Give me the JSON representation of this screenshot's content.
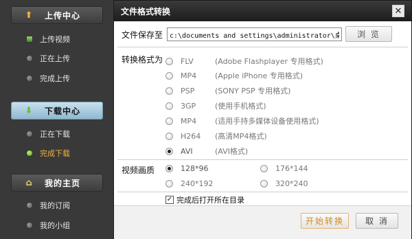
{
  "sidebar": {
    "upload": {
      "header": "上传中心",
      "icon": "up-arrow-icon",
      "items": [
        {
          "label": "上传视频",
          "icon": "video-icon"
        },
        {
          "label": "正在上传",
          "icon": "dot-icon"
        },
        {
          "label": "完成上传",
          "icon": "dot-icon"
        }
      ]
    },
    "download": {
      "header": "下载中心",
      "icon": "down-arrow-icon",
      "items": [
        {
          "label": "正在下载",
          "icon": "dot-icon"
        },
        {
          "label": "完成下载",
          "icon": "check-dot-icon",
          "selected": true
        }
      ]
    },
    "home": {
      "header": "我的主页",
      "icon": "house-icon",
      "items": [
        {
          "label": "我的订阅",
          "icon": "dot-icon"
        },
        {
          "label": "我的小组",
          "icon": "dot-icon"
        }
      ]
    }
  },
  "dialog": {
    "title": "文件格式转换",
    "close_symbol": "✕",
    "save_location_label": "文件保存至",
    "save_path": "c:\\documents and settings\\administrator\\桌面",
    "browse_label": "浏 览",
    "format_label": "转换格式为",
    "formats": [
      {
        "name": "FLV",
        "desc": "(Adobe Flashplayer 专用格式)",
        "selected": false
      },
      {
        "name": "MP4",
        "desc": "(Apple iPhone 专用格式)",
        "selected": false
      },
      {
        "name": "PSP",
        "desc": "(SONY PSP 专用格式)",
        "selected": false
      },
      {
        "name": "3GP",
        "desc": "(使用手机格式)",
        "selected": false
      },
      {
        "name": "MP4",
        "desc": "(适用手持多媒体设备使用格式)",
        "selected": false
      },
      {
        "name": "H264",
        "desc": "(高清MP4格式)",
        "selected": false
      },
      {
        "name": "AVI",
        "desc": "(AVI格式)",
        "selected": true
      }
    ],
    "quality_label": "视频画质",
    "qualities": [
      {
        "value": "128*96",
        "selected": true
      },
      {
        "value": "176*144",
        "selected": false
      },
      {
        "value": "240*192",
        "selected": false
      },
      {
        "value": "320*240",
        "selected": false
      }
    ],
    "open_folder_label": "完成后打开所在目录",
    "open_folder_checked": true,
    "start_label": "开始转换",
    "cancel_label": "取 消"
  },
  "colors": {
    "accent_orange": "#f5b23a",
    "dialog_title_bg": "#1d1d1d",
    "sidebar_bg": "#393939"
  }
}
